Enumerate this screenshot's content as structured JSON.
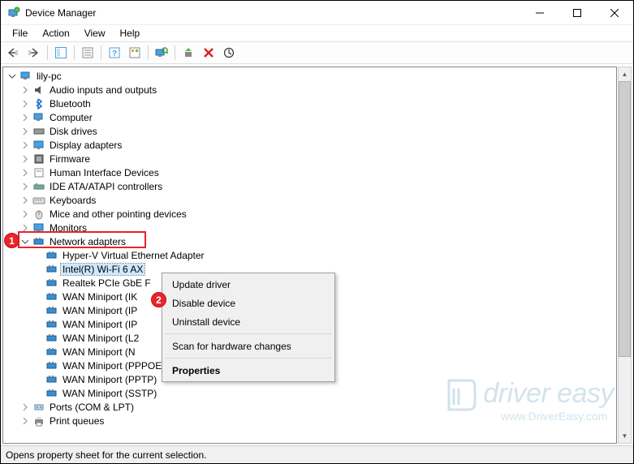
{
  "window": {
    "title": "Device Manager"
  },
  "menubar": {
    "items": [
      "File",
      "Action",
      "View",
      "Help"
    ]
  },
  "tree": {
    "root": "lily-pc",
    "categories": [
      {
        "label": "Audio inputs and outputs",
        "icon": "audio"
      },
      {
        "label": "Bluetooth",
        "icon": "bluetooth"
      },
      {
        "label": "Computer",
        "icon": "computer"
      },
      {
        "label": "Disk drives",
        "icon": "disk"
      },
      {
        "label": "Display adapters",
        "icon": "display"
      },
      {
        "label": "Firmware",
        "icon": "firmware"
      },
      {
        "label": "Human Interface Devices",
        "icon": "hid"
      },
      {
        "label": "IDE ATA/ATAPI controllers",
        "icon": "ide"
      },
      {
        "label": "Keyboards",
        "icon": "keyboard"
      },
      {
        "label": "Mice and other pointing devices",
        "icon": "mouse"
      },
      {
        "label": "Monitors",
        "icon": "monitor"
      }
    ],
    "network": {
      "label": "Network adapters",
      "children": [
        "Hyper-V Virtual Ethernet Adapter",
        "Intel(R) Wi-Fi 6 AX",
        "Realtek PCIe GbE F",
        "WAN Miniport (IK",
        "WAN Miniport (IP",
        "WAN Miniport (IP",
        "WAN Miniport (L2",
        "WAN Miniport (N",
        "WAN Miniport (PPPOE)",
        "WAN Miniport (PPTP)",
        "WAN Miniport (SSTP)"
      ]
    },
    "after": [
      {
        "label": "Ports (COM & LPT)",
        "icon": "port"
      },
      {
        "label": "Print queues",
        "icon": "print"
      }
    ]
  },
  "context_menu": {
    "items": [
      {
        "label": "Update driver",
        "type": "item"
      },
      {
        "label": "Disable device",
        "type": "item"
      },
      {
        "label": "Uninstall device",
        "type": "item",
        "highlight": true
      },
      {
        "type": "sep"
      },
      {
        "label": "Scan for hardware changes",
        "type": "item"
      },
      {
        "type": "sep"
      },
      {
        "label": "Properties",
        "type": "item",
        "bold": true
      }
    ]
  },
  "callouts": {
    "one": "1",
    "two": "2"
  },
  "statusbar": {
    "text": "Opens property sheet for the current selection."
  },
  "watermark": {
    "brand": "driver easy",
    "url": "www.DriverEasy.com"
  }
}
